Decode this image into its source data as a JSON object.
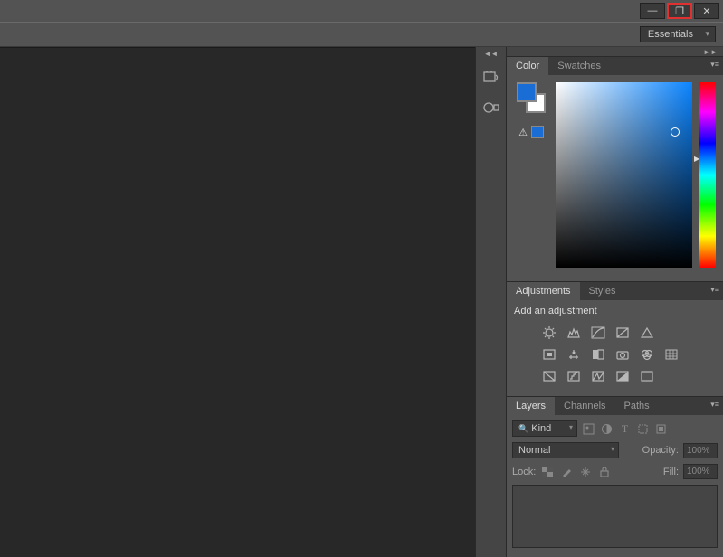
{
  "titlebar": {
    "minimize": "—",
    "restore": "❐",
    "close": "✕"
  },
  "workspace": {
    "selected": "Essentials"
  },
  "colorPanel": {
    "tabs": [
      "Color",
      "Swatches"
    ],
    "activeTab": 0,
    "foreground": "#1b6dd6",
    "background": "#ffffff"
  },
  "adjustments": {
    "tabs": [
      "Adjustments",
      "Styles"
    ],
    "activeTab": 0,
    "label": "Add an adjustment"
  },
  "layers": {
    "tabs": [
      "Layers",
      "Channels",
      "Paths"
    ],
    "activeTab": 0,
    "kind": "Kind",
    "blendMode": "Normal",
    "opacityLabel": "Opacity:",
    "opacity": "100%",
    "lockLabel": "Lock:",
    "fillLabel": "Fill:",
    "fill": "100%"
  }
}
